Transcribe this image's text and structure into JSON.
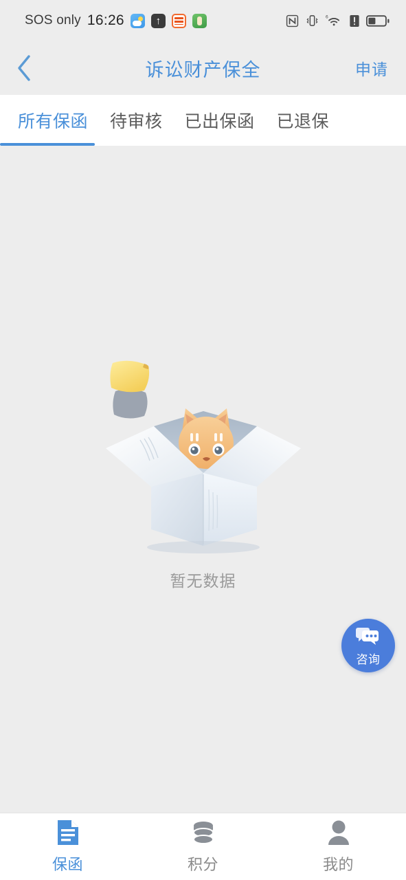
{
  "statusbar": {
    "carrier": "SOS only",
    "time": "16:26",
    "app_icons": [
      "weather-app-icon",
      "upload-arrow-icon",
      "orange-app-icon",
      "green-app-icon"
    ],
    "right_icons": [
      "nfc-icon",
      "vibrate-icon",
      "wifi-6-icon",
      "signal-alert-icon",
      "battery-icon"
    ]
  },
  "header": {
    "back_label": "back",
    "title": "诉讼财产保全",
    "action_label": "申请"
  },
  "tabs": [
    {
      "label": "所有保函",
      "active": true
    },
    {
      "label": "待审核",
      "active": false
    },
    {
      "label": "已出保函",
      "active": false
    },
    {
      "label": "已退保",
      "active": false
    }
  ],
  "empty_state": {
    "illustration": "cat-in-open-box-illustration",
    "text": "暂无数据"
  },
  "fab": {
    "icon": "chat-bubbles-icon",
    "label": "咨询"
  },
  "bottom_nav": [
    {
      "label": "保函",
      "icon": "document-icon",
      "active": true
    },
    {
      "label": "积分",
      "icon": "coin-stack-icon",
      "active": false
    },
    {
      "label": "我的",
      "icon": "person-icon",
      "active": false
    }
  ],
  "colors": {
    "accent": "#4a90d9",
    "fab_bg": "#4b7ddb",
    "page_bg": "#ededed",
    "surface": "#ffffff",
    "muted_text": "#9a9a9a"
  }
}
